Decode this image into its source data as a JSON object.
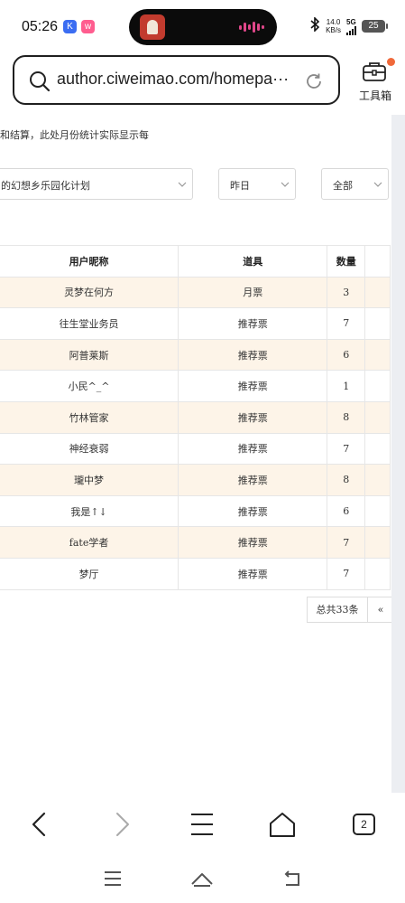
{
  "status_bar": {
    "time": "05:26",
    "app_icon_1": "K",
    "app_icon_2": "ᴡ",
    "net_speed_value": "14.0",
    "net_speed_unit": "KB/s",
    "network": "5G",
    "battery": "25"
  },
  "address_bar": {
    "url": "author.ciweimao.com/homepa···",
    "toolbox_label": "工具箱"
  },
  "page": {
    "notice": "和结算，此处月份统计实际显示每",
    "filters": {
      "book": "的幻想乡乐园化计划",
      "date": "昨日",
      "type": "全部"
    },
    "table": {
      "headers": [
        "用户昵称",
        "道具",
        "数量",
        ""
      ],
      "rows": [
        {
          "user": "灵梦在何方",
          "item": "月票",
          "count": "3"
        },
        {
          "user": "往生堂业务员",
          "item": "推荐票",
          "count": "7"
        },
        {
          "user": "阿普莱斯",
          "item": "推荐票",
          "count": "6"
        },
        {
          "user": "小民^_^",
          "item": "推荐票",
          "count": "1"
        },
        {
          "user": "竹林管家",
          "item": "推荐票",
          "count": "8"
        },
        {
          "user": "神经衰弱",
          "item": "推荐票",
          "count": "7"
        },
        {
          "user": "瓏中梦",
          "item": "推荐票",
          "count": "8"
        },
        {
          "user": "我是↑↓",
          "item": "推荐票",
          "count": "6"
        },
        {
          "user": "fate学者",
          "item": "推荐票",
          "count": "7"
        },
        {
          "user": "梦厅",
          "item": "推荐票",
          "count": "7"
        }
      ]
    },
    "pagination": {
      "total": "总共33条",
      "prev": "«"
    }
  },
  "browser_nav": {
    "tab_count": "2",
    "icons": [
      "back-icon",
      "forward-icon",
      "menu-icon",
      "home-icon",
      "tabs-icon"
    ]
  },
  "system_nav": {
    "icons": [
      "recents-icon",
      "home-icon",
      "back-icon"
    ]
  }
}
